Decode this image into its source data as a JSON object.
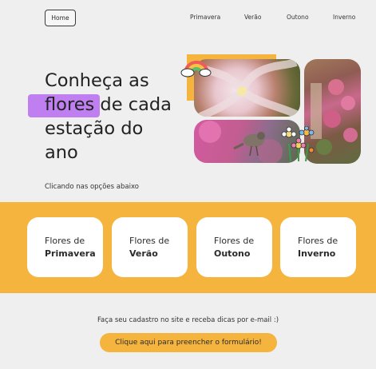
{
  "nav": {
    "home_label": "Home",
    "items": [
      "Primavera",
      "Verão",
      "Outono",
      "Inverno"
    ]
  },
  "hero": {
    "title_line1": "Conheça as",
    "title_highlight": "flores",
    "title_line2_rest": " de cada",
    "title_line3": "estação do",
    "title_line4": "ano",
    "subtitle": "Clicando nas opções abaixo"
  },
  "cards": [
    {
      "prefix": "Flores de",
      "season": "Primavera"
    },
    {
      "prefix": "Flores de",
      "season": "Verão"
    },
    {
      "prefix": "Flores de",
      "season": "Outono"
    },
    {
      "prefix": "Flores de",
      "season": "Inverno"
    }
  ],
  "footer": {
    "cta_text": "Faça seu cadastro no site e receba dicas por e-mail :)",
    "cta_button": "Clique aqui para preencher o formulário!"
  },
  "colors": {
    "accent_yellow": "#f4b43d",
    "highlight_purple": "#c07ff0",
    "background": "#f0efef"
  }
}
